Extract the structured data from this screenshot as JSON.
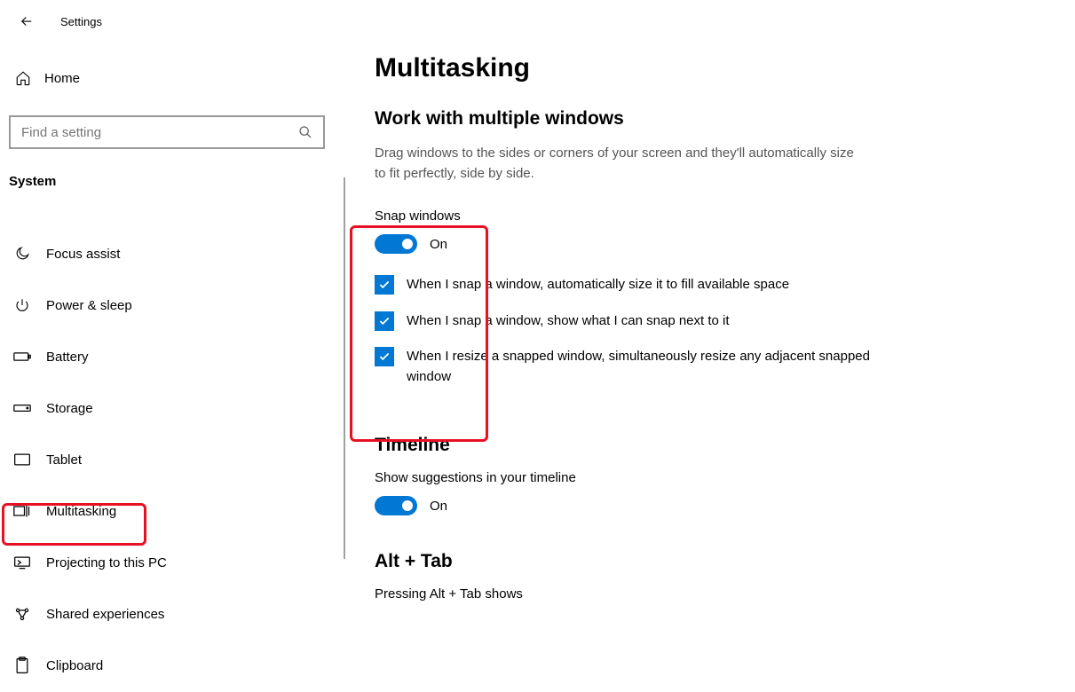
{
  "header": {
    "app_title": "Settings"
  },
  "sidebar": {
    "home_label": "Home",
    "search_placeholder": "Find a setting",
    "category": "System",
    "items": [
      {
        "id": "focus-assist",
        "label": "Focus assist",
        "icon": "moon"
      },
      {
        "id": "power-sleep",
        "label": "Power & sleep",
        "icon": "power"
      },
      {
        "id": "battery",
        "label": "Battery",
        "icon": "battery"
      },
      {
        "id": "storage",
        "label": "Storage",
        "icon": "storage"
      },
      {
        "id": "tablet",
        "label": "Tablet",
        "icon": "tablet"
      },
      {
        "id": "multitasking",
        "label": "Multitasking",
        "icon": "multitasking"
      },
      {
        "id": "projecting",
        "label": "Projecting to this PC",
        "icon": "projecting"
      },
      {
        "id": "shared-experiences",
        "label": "Shared experiences",
        "icon": "shared"
      },
      {
        "id": "clipboard",
        "label": "Clipboard",
        "icon": "clipboard"
      }
    ]
  },
  "main": {
    "title": "Multitasking",
    "section1": {
      "heading": "Work with multiple windows",
      "description": "Drag windows to the sides or corners of your screen and they'll automatically size to fit perfectly, side by side.",
      "snap_label": "Snap windows",
      "snap_state": "On",
      "checkboxes": [
        "When I snap a window, automatically size it to fill available space",
        "When I snap a window, show what I can snap next to it",
        "When I resize a snapped window, simultaneously resize any adjacent snapped window"
      ]
    },
    "section2": {
      "heading": "Timeline",
      "toggle_label": "Show suggestions in your timeline",
      "toggle_state": "On"
    },
    "section3": {
      "heading": "Alt + Tab",
      "label": "Pressing Alt + Tab shows"
    }
  }
}
